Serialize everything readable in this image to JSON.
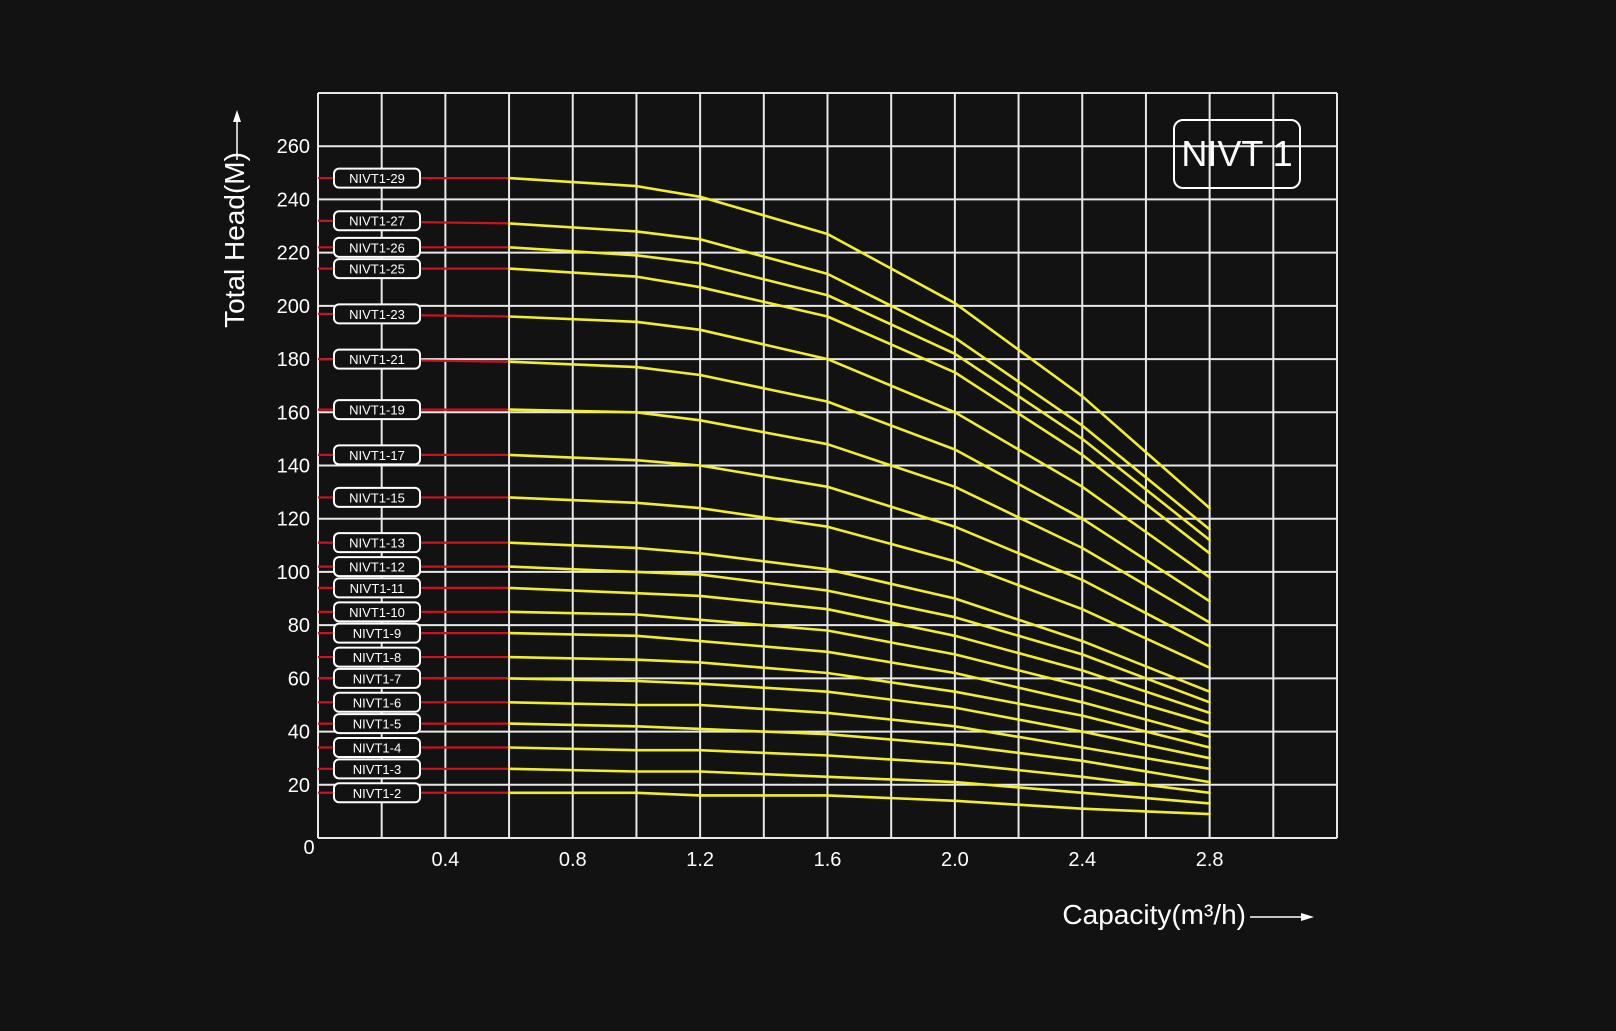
{
  "chart_data": {
    "type": "line",
    "title": "NIVT 1",
    "xlabel": "Capacity(m³/h)",
    "ylabel": "Total Head(M)",
    "xlim": [
      0,
      3.2
    ],
    "ylim": [
      0,
      280
    ],
    "xticks": [
      0,
      0.4,
      0.8,
      1.2,
      1.6,
      2.0,
      2.4,
      2.8
    ],
    "xtick_labels": [
      "0",
      "0.4",
      "0.8",
      "1.2",
      "1.6",
      "2.0",
      "2.4",
      "2.8"
    ],
    "yticks": [
      20,
      40,
      60,
      80,
      100,
      120,
      140,
      160,
      180,
      200,
      220,
      240,
      260
    ],
    "ytick_labels": [
      "20",
      "40",
      "60",
      "80",
      "100",
      "120",
      "140",
      "160",
      "180",
      "200",
      "220",
      "240",
      "260"
    ],
    "grid": true,
    "x": [
      0,
      0.6,
      1.0,
      1.2,
      1.6,
      2.0,
      2.4,
      2.8
    ],
    "series": [
      {
        "name": "NIVT1-29",
        "values": [
          248,
          248,
          245,
          241,
          227,
          201,
          166,
          124
        ]
      },
      {
        "name": "NIVT1-27",
        "values": [
          232,
          231,
          228,
          225,
          212,
          188,
          155,
          116
        ]
      },
      {
        "name": "NIVT1-26",
        "values": [
          222,
          222,
          219,
          216,
          204,
          182,
          150,
          112
        ]
      },
      {
        "name": "NIVT1-25",
        "values": [
          214,
          214,
          211,
          207,
          196,
          175,
          144,
          107
        ]
      },
      {
        "name": "NIVT1-23",
        "values": [
          197,
          196,
          194,
          191,
          180,
          160,
          132,
          98
        ]
      },
      {
        "name": "NIVT1-21",
        "values": [
          180,
          179,
          177,
          174,
          164,
          146,
          120,
          89
        ]
      },
      {
        "name": "NIVT1-19",
        "values": [
          161,
          161,
          160,
          157,
          148,
          132,
          109,
          81
        ]
      },
      {
        "name": "NIVT1-17",
        "values": [
          144,
          144,
          142,
          140,
          132,
          117,
          97,
          72
        ]
      },
      {
        "name": "NIVT1-15",
        "values": [
          128,
          128,
          126,
          124,
          117,
          104,
          86,
          64
        ]
      },
      {
        "name": "NIVT1-13",
        "values": [
          111,
          111,
          109,
          107,
          101,
          90,
          74,
          55
        ]
      },
      {
        "name": "NIVT1-12",
        "values": [
          102,
          102,
          100,
          99,
          93,
          83,
          69,
          51
        ]
      },
      {
        "name": "NIVT1-11",
        "values": [
          94,
          94,
          92,
          91,
          86,
          76,
          63,
          47
        ]
      },
      {
        "name": "NIVT1-10",
        "values": [
          85,
          85,
          84,
          82,
          78,
          69,
          57,
          43
        ]
      },
      {
        "name": "NIVT1-9",
        "values": [
          77,
          77,
          76,
          74,
          70,
          62,
          51,
          38
        ]
      },
      {
        "name": "NIVT1-8",
        "values": [
          68,
          68,
          67,
          66,
          62,
          55,
          46,
          34
        ]
      },
      {
        "name": "NIVT1-7",
        "values": [
          60,
          60,
          59,
          58,
          55,
          49,
          40,
          30
        ]
      },
      {
        "name": "NIVT1-6",
        "values": [
          51,
          51,
          50,
          50,
          47,
          42,
          34,
          26
        ]
      },
      {
        "name": "NIVT1-5",
        "values": [
          43,
          43,
          42,
          41,
          39,
          35,
          29,
          21
        ]
      },
      {
        "name": "NIVT1-4",
        "values": [
          34,
          34,
          33,
          33,
          31,
          28,
          23,
          17
        ]
      },
      {
        "name": "NIVT1-3",
        "values": [
          26,
          26,
          25,
          25,
          23,
          21,
          17,
          13
        ]
      },
      {
        "name": "NIVT1-2",
        "values": [
          17,
          17,
          17,
          16,
          16,
          14,
          11,
          9
        ]
      }
    ],
    "colors": {
      "background": "#121212",
      "grid": "#e8e8e8",
      "curve": "#f2ee2e",
      "shutoff": "#c8141e",
      "text": "#ffffff"
    }
  }
}
